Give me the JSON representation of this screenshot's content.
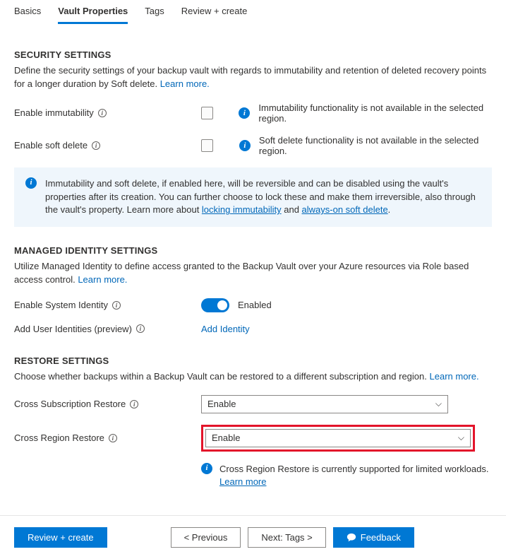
{
  "tabs": {
    "basics": "Basics",
    "vault": "Vault Properties",
    "tags": "Tags",
    "review": "Review + create"
  },
  "security": {
    "title": "SECURITY SETTINGS",
    "desc": "Define the security settings of your backup vault with regards to immutability and retention of deleted recovery points for a longer duration by Soft delete.",
    "learn": "Learn more.",
    "immutability_label": "Enable immutability",
    "immutability_msg": "Immutability functionality is not available in the selected region.",
    "softdelete_label": "Enable soft delete",
    "softdelete_msg": "Soft delete functionality is not available in the selected region.",
    "callout_pre": "Immutability and soft delete, if enabled here, will be reversible and can be disabled using the vault's properties after its creation. You can further choose to lock these and make them irreversible, also through the vault's property. Learn more about ",
    "callout_link1": "locking immutability",
    "callout_mid": " and ",
    "callout_link2": "always-on soft delete",
    "callout_post": "."
  },
  "identity": {
    "title": "MANAGED IDENTITY SETTINGS",
    "desc": "Utilize Managed Identity to define access granted to the Backup Vault over your Azure resources via Role based access control.",
    "learn": "Learn more.",
    "system_label": "Enable System Identity",
    "toggle_text": "Enabled",
    "add_user_label": "Add User Identities (preview)",
    "add_identity_link": "Add Identity"
  },
  "restore": {
    "title": "RESTORE SETTINGS",
    "desc": "Choose whether backups within a Backup Vault can be restored to a different subscription and region.",
    "learn": "Learn more.",
    "cross_sub_label": "Cross Subscription Restore",
    "cross_sub_value": "Enable",
    "cross_region_label": "Cross Region Restore",
    "cross_region_value": "Enable",
    "info_msg": "Cross Region Restore is currently supported for limited workloads. ",
    "info_link": "Learn more"
  },
  "footer": {
    "review": "Review + create",
    "prev": "< Previous",
    "next": "Next: Tags >",
    "feedback": "Feedback"
  }
}
